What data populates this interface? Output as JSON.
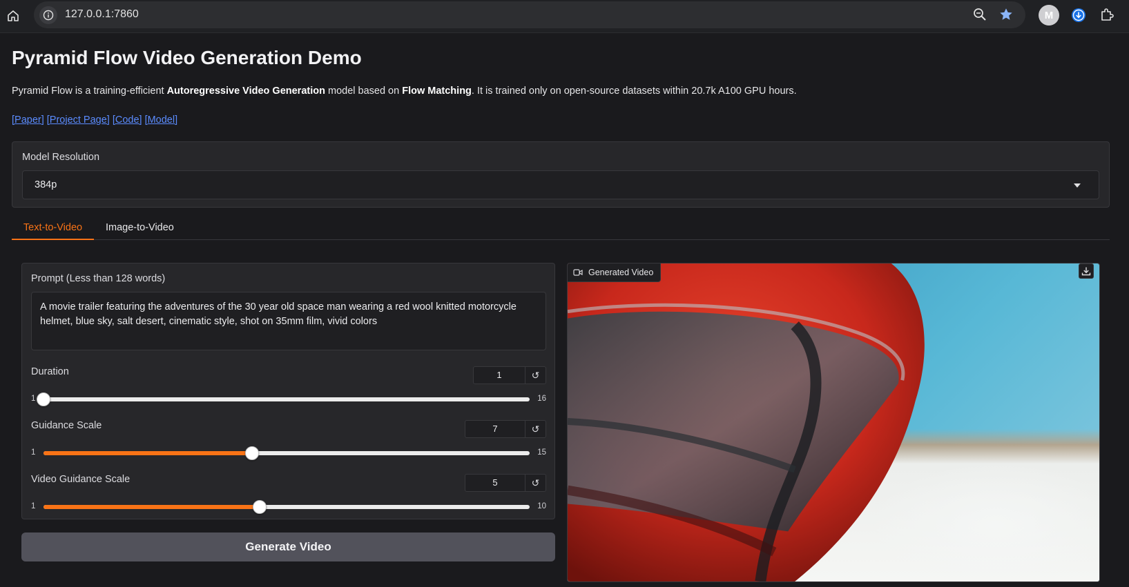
{
  "browser": {
    "url": "127.0.0.1:7860",
    "avatar_letter": "M",
    "icons": [
      "home-icon",
      "site-info-icon",
      "zoom-icon",
      "bookmark-star-icon",
      "download-icon",
      "extensions-icon"
    ]
  },
  "page": {
    "title": "Pyramid Flow Video Generation Demo",
    "description": {
      "p1": "Pyramid Flow is a training-efficient ",
      "b1": "Autoregressive Video Generation",
      "p2": " model based on ",
      "b2": "Flow Matching",
      "p3": ". It is trained only on open-source datasets within 20.7k A100 GPU hours."
    },
    "links": [
      "[Paper]",
      "[Project Page]",
      "[Code]",
      "[Model]"
    ]
  },
  "resolution": {
    "label": "Model Resolution",
    "value": "384p"
  },
  "tabs": [
    {
      "label": "Text-to-Video",
      "active": true
    },
    {
      "label": "Image-to-Video",
      "active": false
    }
  ],
  "prompt": {
    "label": "Prompt (Less than 128 words)",
    "value": "A movie trailer featuring the adventures of the 30 year old space man wearing a red wool knitted motorcycle helmet, blue sky, salt desert, cinematic style, shot on 35mm film, vivid colors"
  },
  "sliders": [
    {
      "name": "Duration",
      "value": "1",
      "min": "1",
      "max": "16",
      "fraction": 0.0
    },
    {
      "name": "Guidance Scale",
      "value": "7",
      "min": "1",
      "max": "15",
      "fraction": 0.4286
    },
    {
      "name": "Video Guidance Scale",
      "value": "5",
      "min": "1",
      "max": "10",
      "fraction": 0.4444
    }
  ],
  "generate_button": "Generate Video",
  "output": {
    "label": "Generated Video"
  },
  "colors": {
    "accent": "#f97316",
    "link": "#5b8cff",
    "background": "#1a1a1d",
    "panel": "#27272a"
  }
}
